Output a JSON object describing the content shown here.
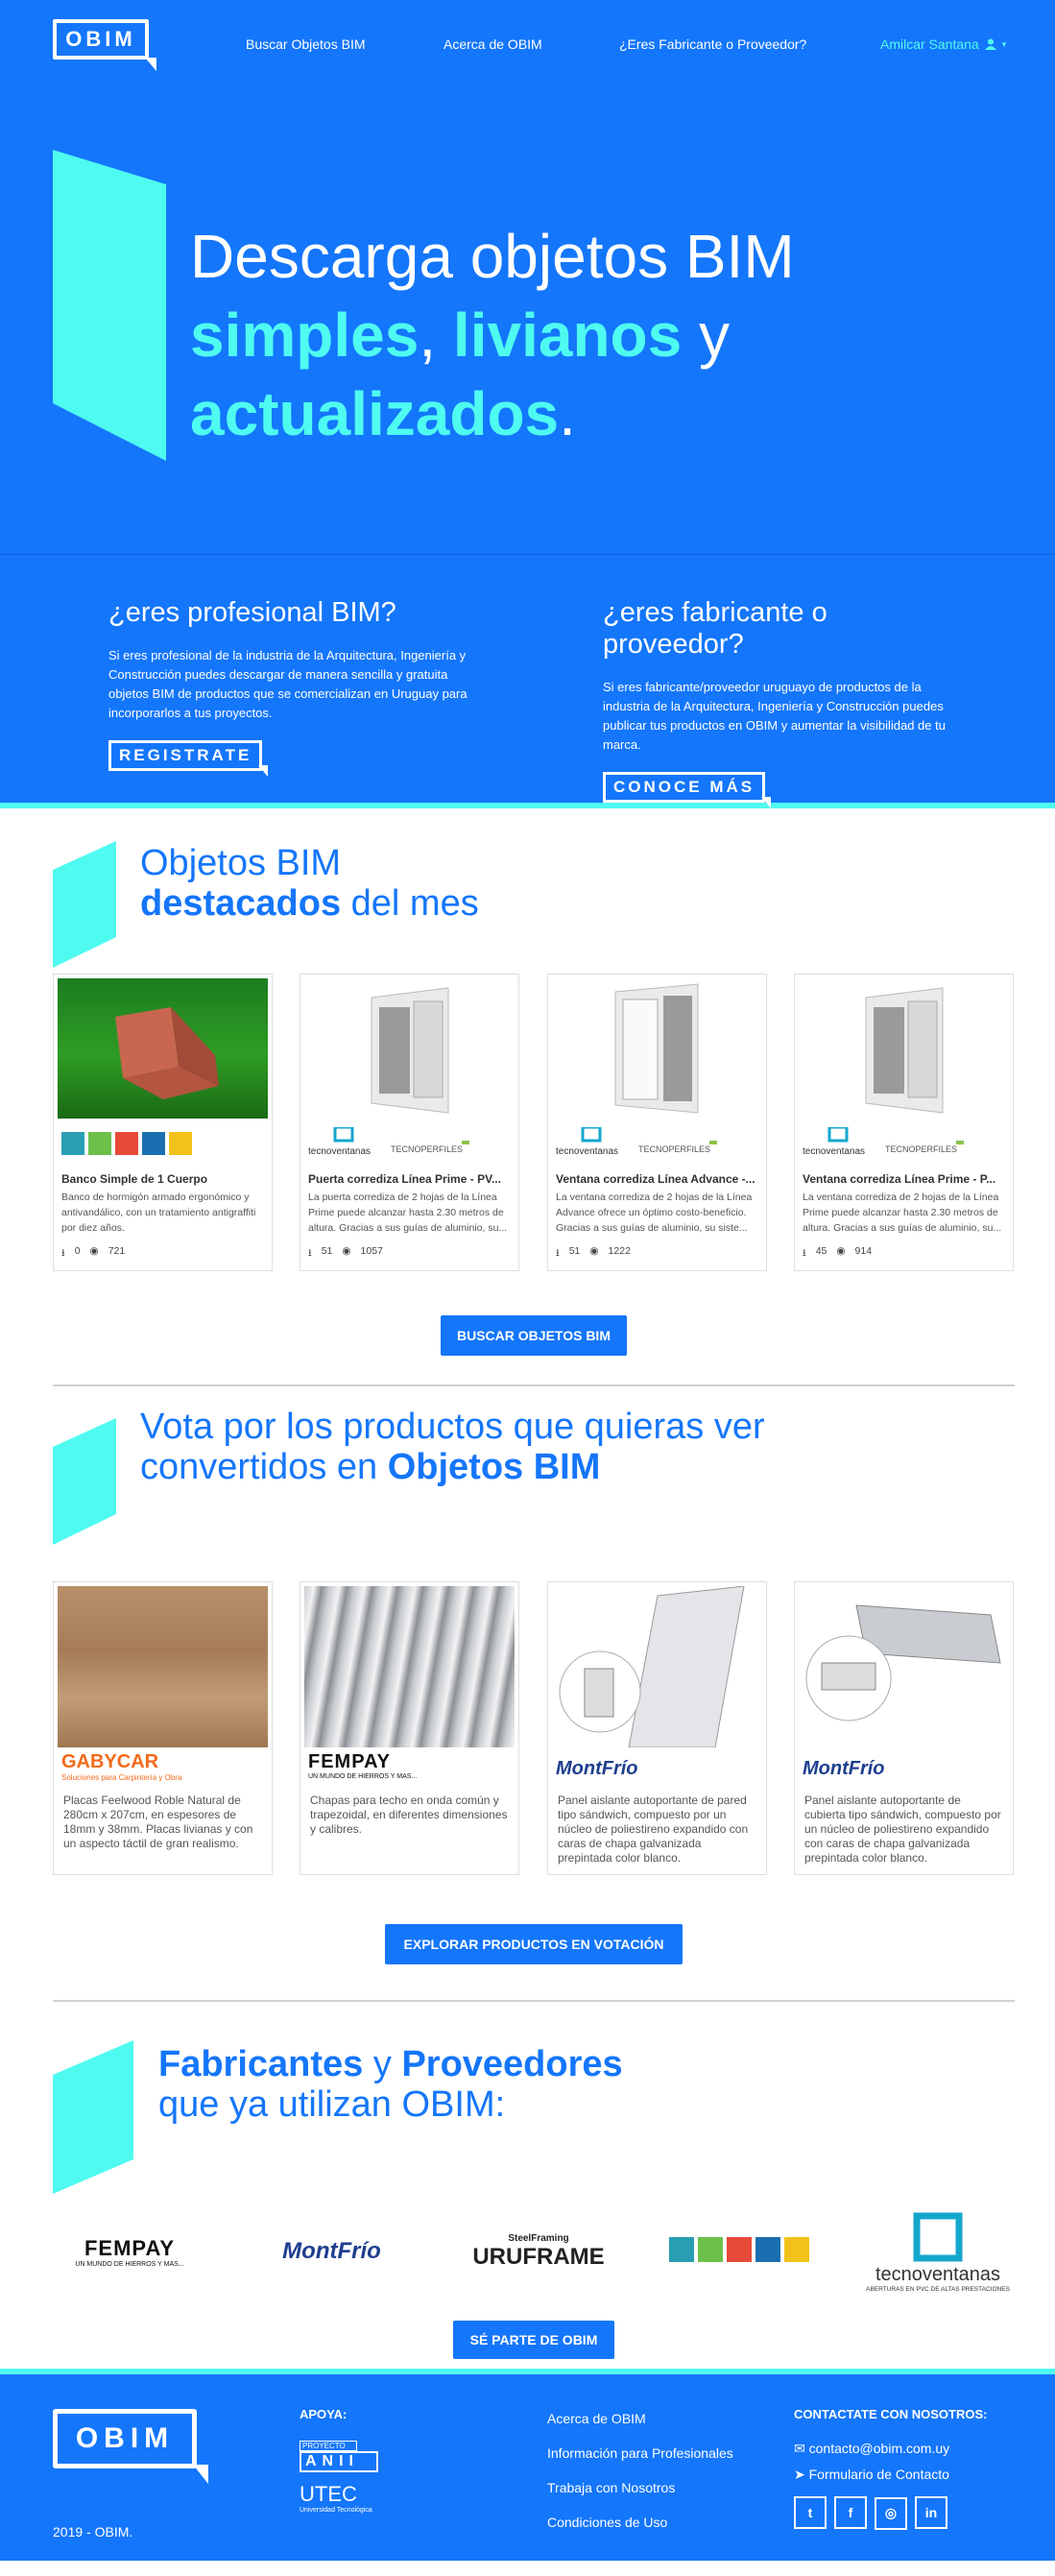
{
  "nav": {
    "logo_text": "OBIM",
    "links": [
      "Buscar Objetos BIM",
      "Acerca de OBIM",
      "¿Eres Fabricante o Proveedor?"
    ],
    "user": "Amilcar Santana"
  },
  "hero": {
    "line1": "Descarga objetos BIM",
    "w1": "simples",
    "comma": ", ",
    "w2": "livianos",
    "y": " y",
    "w3": "actualizados",
    "dot": "."
  },
  "profiles": {
    "left": {
      "title": "¿eres profesional BIM?",
      "text": "Si eres profesional de la industria de la Arquitectura, Ingeniería y Construcción puedes descargar de manera sencilla y gratuita objetos BIM de productos que se comercializan en Uruguay para incorporarlos a tus proyectos.",
      "button": "REGISTRATE"
    },
    "right": {
      "title": "¿eres fabricante o proveedor?",
      "text": "Si eres fabricante/proveedor uruguayo de productos de la industria de la Arquitectura, Ingeniería y Construcción puedes publicar tus productos en OBIM y aumentar la visibilidad de tu marca.",
      "button": "CONOCE MÁS"
    }
  },
  "featured": {
    "title_l1": "Objetos BIM",
    "title_b": "destacados",
    "title_rest": " del mes",
    "cards": [
      {
        "title": "Banco Simple de 1 Cuerpo",
        "desc": "Banco de hormigón armado ergonómico y antivandálico, con un tratamiento antigraffiti por diez años.",
        "downloads": "0",
        "views": "721"
      },
      {
        "title": "Puerta corrediza Línea Prime - PV...",
        "desc": "La puerta corrediza de 2 hojas de la Línea Prime puede alcanzar hasta 2.30 metros de altura. Gracias a sus guías de aluminio, su...",
        "downloads": "51",
        "views": "1057"
      },
      {
        "title": "Ventana corrediza Línea Advance -...",
        "desc": "La ventana corrediza de 2 hojas de la Línea Advance ofrece un óptimo costo-beneficio. Gracias a sus guías de aluminio, su siste...",
        "downloads": "51",
        "views": "1222"
      },
      {
        "title": "Ventana corrediza Línea Prime - P...",
        "desc": "La ventana corrediza de 2 hojas de la Línea Prime puede alcanzar hasta 2.30 metros de altura. Gracias a sus guías de aluminio, su...",
        "downloads": "45",
        "views": "914"
      }
    ],
    "button": "BUSCAR OBJETOS BIM"
  },
  "vote": {
    "title_l1": "Vota por los productos que quieras ver",
    "title_l2": "convertidos en ",
    "title_b": "Objetos BIM",
    "cards": [
      {
        "brand": "GABYCAR",
        "tag": "Soluciones para Carpintería y Obra",
        "desc": "Placas Feelwood Roble Natural de 280cm x 207cm, en espesores de 18mm y 38mm. Placas livianas y con un aspecto táctil de gran realismo."
      },
      {
        "brand": "FEMPAY",
        "tag": "UN MUNDO DE HIERROS Y MAS...",
        "desc": "Chapas para techo en onda común y trapezoidal, en diferentes dimensiones y calibres."
      },
      {
        "brand": "MontFrío",
        "tag": "",
        "desc": "Panel aislante autoportante de pared tipo sándwich, compuesto por un núcleo de poliestireno expandido con caras de chapa galvanizada prepintada color blanco."
      },
      {
        "brand": "MontFrío",
        "tag": "",
        "desc": "Panel aislante autoportante de cubierta tipo sándwich, compuesto por un núcleo de poliestireno expandido con caras de chapa galvanizada prepintada color blanco."
      }
    ],
    "button": "EXPLORAR PRODUCTOS EN VOTACIÓN"
  },
  "makers": {
    "title_b1": "Fabricantes",
    "title_y": " y ",
    "title_b2": "Proveedores",
    "title_l2": "que ya utilizan OBIM:",
    "logos": {
      "fempay": "FEMPAY",
      "fempay_tag": "UN MUNDO DE HIERROS Y MAS...",
      "montfrio": "MontFrío",
      "uruframe_top": "SteelFraming",
      "uruframe": "URUFRAME",
      "tecno": "tecnoventanas",
      "tecno_tag": "ABERTURAS EN PVC DE ALTAS PRESTACIONES"
    },
    "button": "SÉ PARTE DE OBIM"
  },
  "footer": {
    "logo_text": "OBIM",
    "copyright": "2019 - OBIM.",
    "apoya": "APOYA:",
    "anii_top": "PROYECTO",
    "anii": "ANII",
    "utec": "UTEC",
    "utec_sub": "Universidad Tecnológica",
    "links": [
      "Acerca de OBIM",
      "Información para Profesionales",
      "Trabaja con Nosotros",
      "Condiciones de Uso"
    ],
    "contact_head": "CONTACTATE CON NOSOTROS:",
    "email": "contacto@obim.com.uy",
    "form": "Formulario de Contacto"
  }
}
